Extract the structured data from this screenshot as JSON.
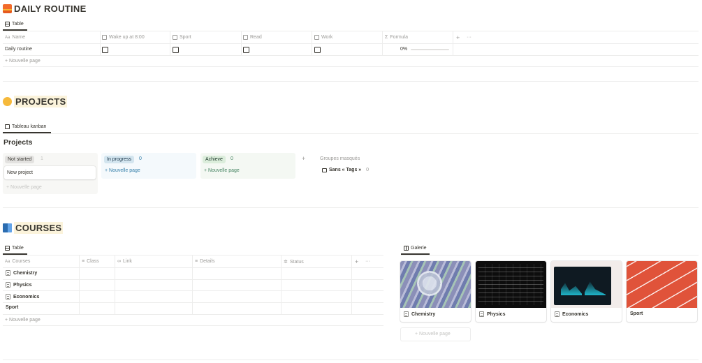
{
  "daily": {
    "title": "DAILY ROUTINE",
    "tab": "Table",
    "columns": [
      "Name",
      "Wake up at 8:00",
      "Sport",
      "Read",
      "Work",
      "Formula"
    ],
    "add_col": "+",
    "more": "···",
    "row": {
      "name": "Daily routine",
      "formula": "0%",
      "progress": 0
    },
    "new_page": "+ Nouvelle page"
  },
  "projects": {
    "title": "PROJECTS",
    "tab": "Tableau kanban",
    "board_title": "Projects",
    "groups": [
      {
        "label": "Not started",
        "count": "1",
        "card": "New project",
        "new_page": "+ Nouvelle page"
      },
      {
        "label": "In progress",
        "count": "0",
        "new_page": "+ Nouvelle page"
      },
      {
        "label": "Achieve",
        "count": "0",
        "new_page": "+ Nouvelle page"
      }
    ],
    "add_group": "+",
    "hidden_groups": "Groupes masqués",
    "hidden_item": "Sans « Tags »",
    "hidden_count": "0"
  },
  "courses": {
    "title": "COURSES",
    "tab_table": "Table",
    "tab_gallery": "Galerie",
    "columns": [
      "Courses",
      "Class",
      "Link",
      "Details",
      "Status"
    ],
    "add_col": "+",
    "more": "···",
    "rows": [
      "Chemistry",
      "Physics",
      "Economics",
      "Sport"
    ],
    "new_page": "+ Nouvelle page",
    "gallery": [
      "Chemistry",
      "Physics",
      "Economics",
      "Sport"
    ],
    "gallery_new": "+ Nouvelle page"
  },
  "colors": {
    "accent": "#37352f",
    "gray": "#9b9a97",
    "in_progress_bg": "#d3e5ef",
    "in_progress_col": "#f4f9fc",
    "achieve_bg": "#dbeddb",
    "achieve_col": "#f4f8f3",
    "not_started_bg": "#e3e2e0",
    "not_started_col": "#f7f7f5",
    "blue_text": "#337ea9",
    "green_text": "#448361"
  }
}
